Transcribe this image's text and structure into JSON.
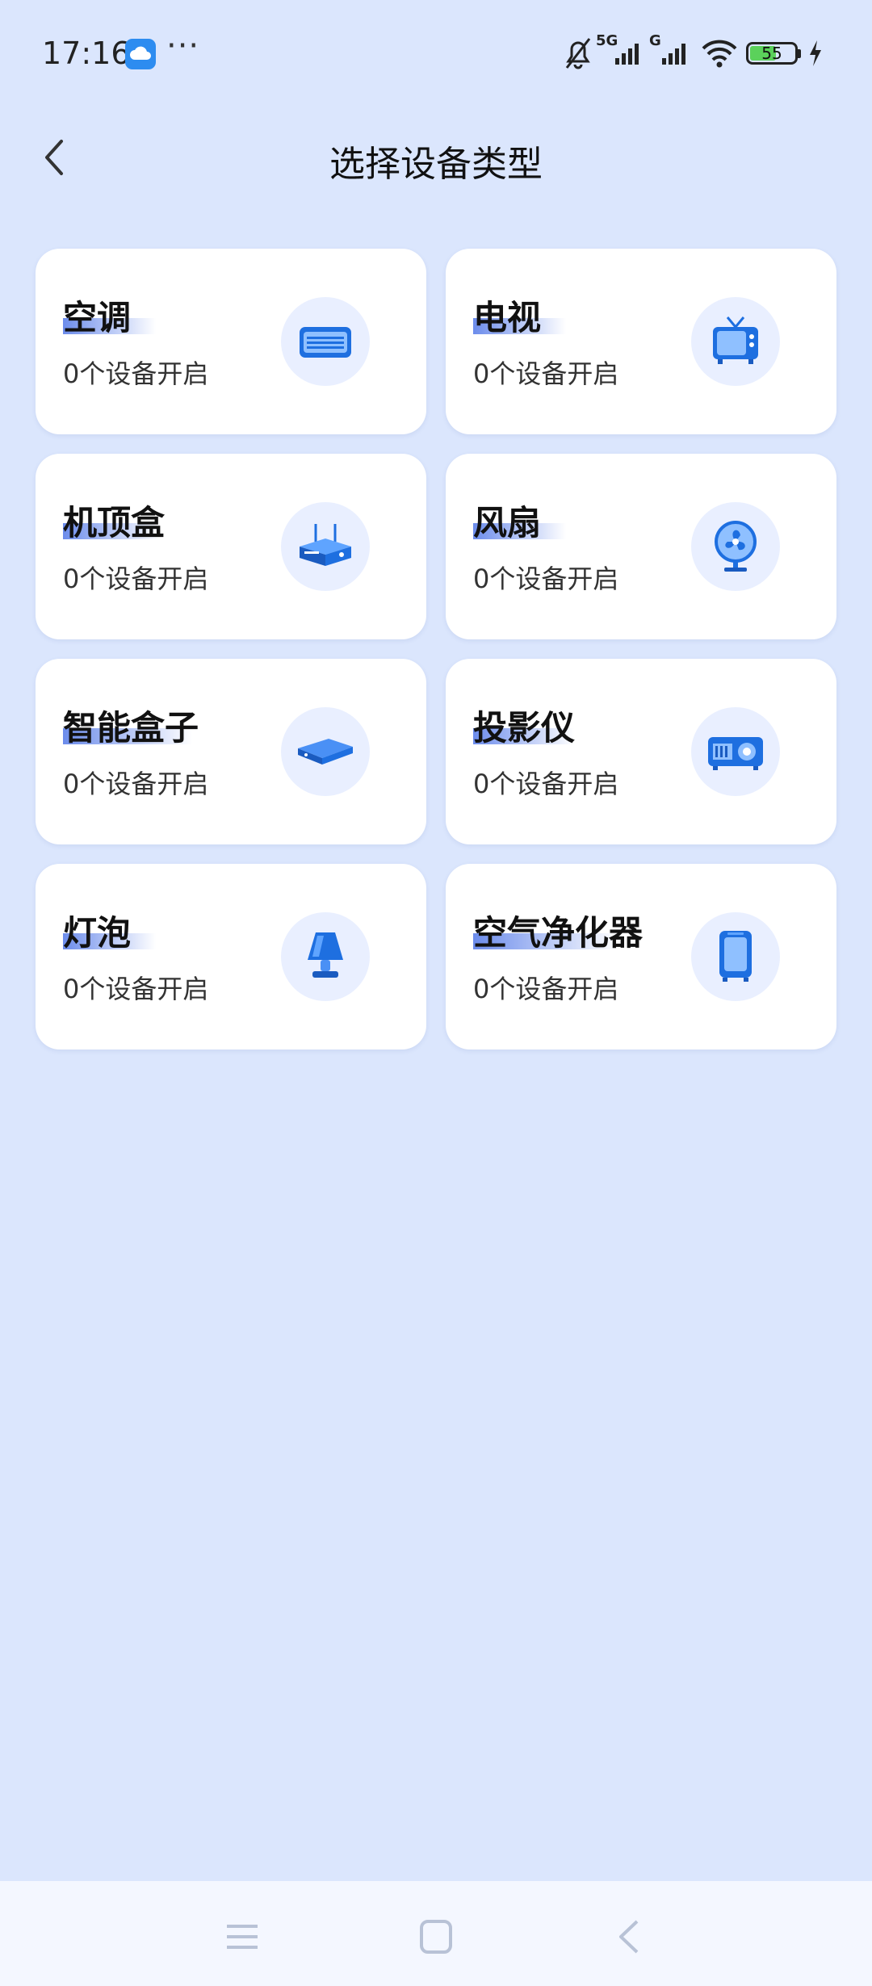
{
  "status_bar": {
    "time": "17:16",
    "network_1": "5G",
    "network_2": "G",
    "battery_level": "55",
    "icons": [
      "cloud-app-icon",
      "more-dots-icon",
      "silent-bell-icon",
      "signal-icon",
      "signal-icon",
      "wifi-icon",
      "battery-icon",
      "charging-bolt-icon"
    ]
  },
  "header": {
    "title": "选择设备类型",
    "back_icon": "chevron-left-icon"
  },
  "device_types": [
    {
      "name": "空调",
      "status": "0个设备开启",
      "icon": "air-conditioner-icon"
    },
    {
      "name": "电视",
      "status": "0个设备开启",
      "icon": "tv-icon"
    },
    {
      "name": "机顶盒",
      "status": "0个设备开启",
      "icon": "set-top-box-icon"
    },
    {
      "name": "风扇",
      "status": "0个设备开启",
      "icon": "fan-icon"
    },
    {
      "name": "智能盒子",
      "status": "0个设备开启",
      "icon": "smart-box-icon"
    },
    {
      "name": "投影仪",
      "status": "0个设备开启",
      "icon": "projector-icon"
    },
    {
      "name": "灯泡",
      "status": "0个设备开启",
      "icon": "lamp-icon"
    },
    {
      "name": "空气净化器",
      "status": "0个设备开启",
      "icon": "air-purifier-icon"
    }
  ],
  "nav_bar": {
    "icons": [
      "menu-icon",
      "home-square-icon",
      "back-triangle-icon"
    ]
  },
  "colors": {
    "background": "#dbe6fd",
    "card": "#ffffff",
    "accent": "#2f6fe0"
  }
}
